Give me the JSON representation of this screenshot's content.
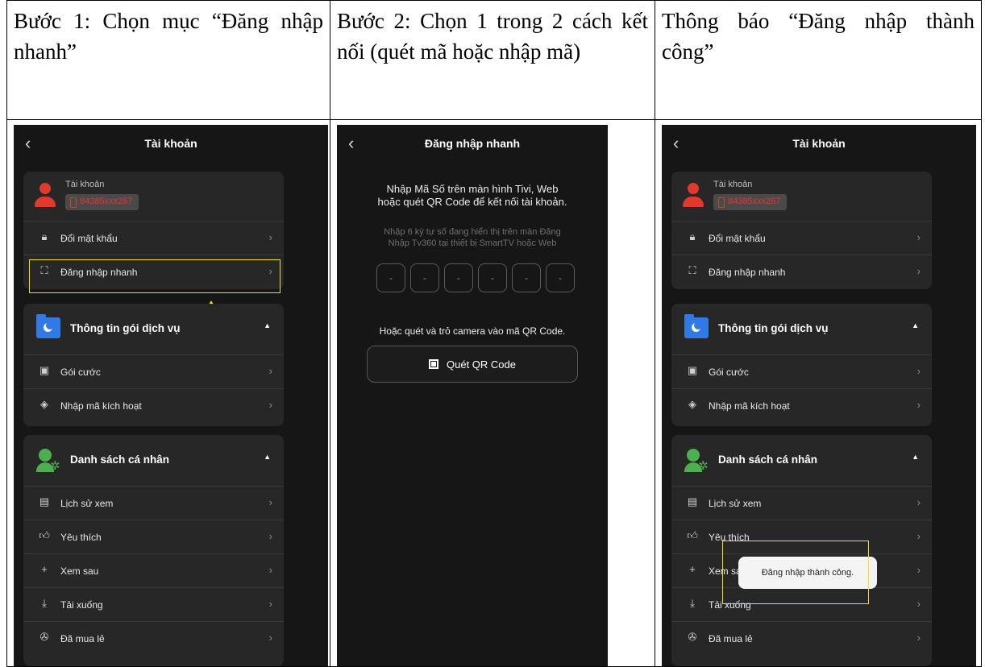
{
  "header": {
    "step1": "Bước 1: Chọn mục “Đăng nhập nhanh”",
    "step2": "Bước 2: Chọn 1 trong 2 cách kết nối (quét mã hoặc nhập mã)",
    "step3": "Thông báo “Đăng nhập thành công”"
  },
  "account_screen": {
    "title": "Tài khoản",
    "back_icon": "chevron-left",
    "account_label": "Tài khoản",
    "phone": "84385xxx267",
    "rows_top": [
      "Đổi mật khẩu",
      "Đăng nhập nhanh"
    ],
    "service_section": "Thông tin gói dịch vụ",
    "service_rows": [
      "Gói cước",
      "Nhập mã kích hoạt"
    ],
    "personal_section": "Danh sách cá nhân",
    "personal_rows": [
      "Lịch sử xem",
      "Yêu thích",
      "Xem sau",
      "Tải xuống",
      "Đã mua lẻ"
    ]
  },
  "quick_login_screen": {
    "title": "Đăng nhập nhanh",
    "intro": "Nhập Mã Số trên màn hình Tivi, Web hoặc quét QR Code để kết nối tài khoản.",
    "hint": "Nhập 6 ký tự số đang hiển thị trên màn Đăng Nhập Tv360 tại thiết bị SmartTV hoặc Web",
    "code_placeholder": "-",
    "or_text": "Hoặc quét và trỏ camera vào mã QR Code.",
    "qr_button": "Quét QR Code"
  },
  "toast": "Đăng nhập thành công.",
  "colors": {
    "background": "#161616",
    "card": "#272727",
    "highlight": "#f5e20b",
    "avatar": "#e03a2c",
    "folder": "#2f7ae5",
    "person": "#4caf50"
  }
}
